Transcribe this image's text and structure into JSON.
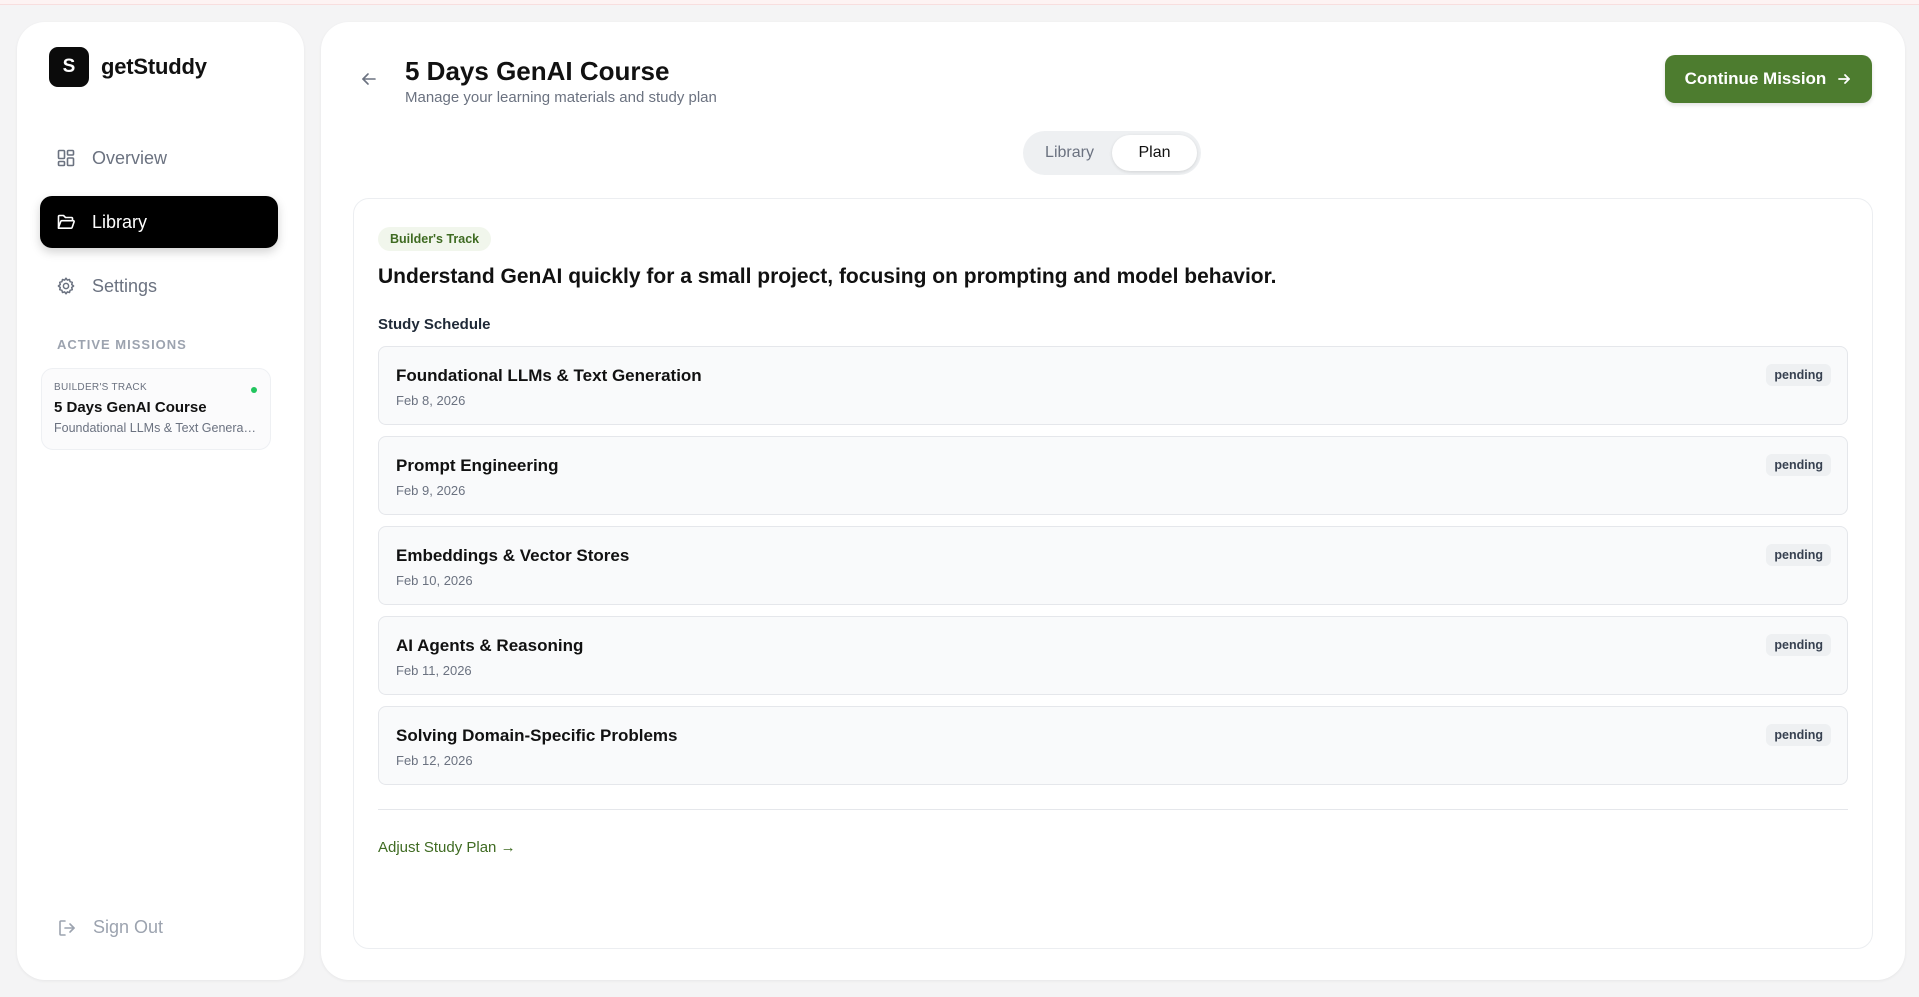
{
  "brand": {
    "logo_letter": "S",
    "name": "getStuddy"
  },
  "nav": {
    "items": [
      {
        "label": "Overview",
        "icon": "grid-icon",
        "active": false
      },
      {
        "label": "Library",
        "icon": "folder-open-icon",
        "active": true
      },
      {
        "label": "Settings",
        "icon": "gear-icon",
        "active": false
      }
    ]
  },
  "active_missions": {
    "label": "ACTIVE MISSIONS",
    "missions": [
      {
        "track": "BUILDER'S TRACK",
        "title": "5 Days GenAI Course",
        "subtitle": "Foundational LLMs & Text Generation",
        "status_color": "#22c55e"
      }
    ]
  },
  "signout": {
    "label": "Sign Out",
    "icon": "logout-icon"
  },
  "header": {
    "title": "5 Days GenAI Course",
    "subtitle": "Manage your learning materials and study plan",
    "continue_label": "Continue Mission"
  },
  "tabs": [
    {
      "label": "Library",
      "active": false
    },
    {
      "label": "Plan",
      "active": true
    }
  ],
  "plan": {
    "track_badge": "Builder's Track",
    "goal": "Understand GenAI quickly for a small project, focusing on prompting and model behavior.",
    "schedule_label": "Study Schedule",
    "sessions": [
      {
        "title": "Foundational LLMs & Text Generation",
        "date": "Feb 8, 2026",
        "status": "pending"
      },
      {
        "title": "Prompt Engineering",
        "date": "Feb 9, 2026",
        "status": "pending"
      },
      {
        "title": "Embeddings & Vector Stores",
        "date": "Feb 10, 2026",
        "status": "pending"
      },
      {
        "title": "AI Agents & Reasoning",
        "date": "Feb 11, 2026",
        "status": "pending"
      },
      {
        "title": "Solving Domain-Specific Problems",
        "date": "Feb 12, 2026",
        "status": "pending"
      }
    ],
    "adjust_label": "Adjust Study Plan →"
  },
  "colors": {
    "accent": "#4d7c2f",
    "accent_text": "#3f6b22",
    "active_nav": "#000000"
  }
}
